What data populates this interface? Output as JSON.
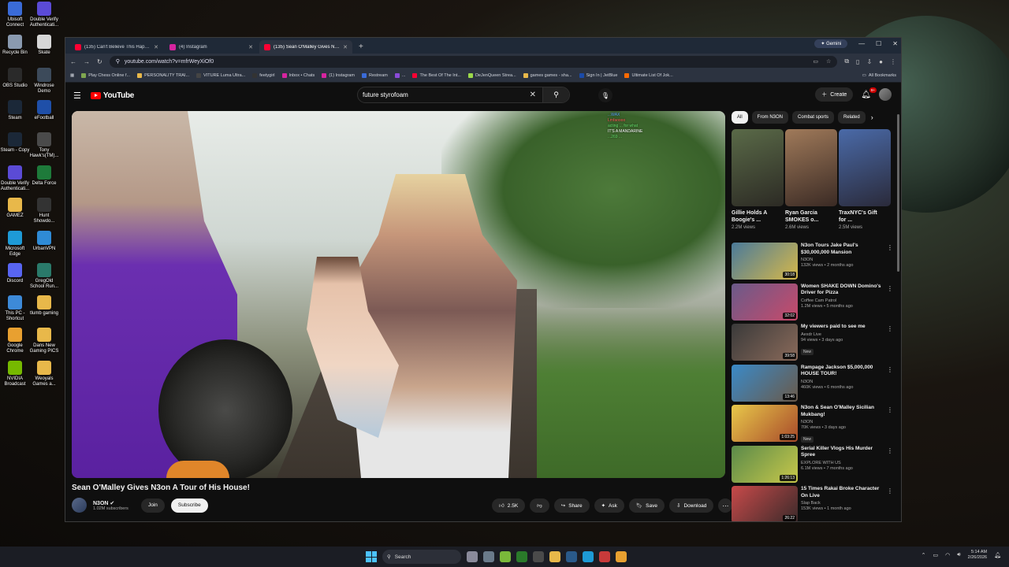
{
  "desktop": {
    "icons": [
      {
        "label": "Ubisoft Connect",
        "icon": "ubisoft-icon",
        "color": "#3a6bd8"
      },
      {
        "label": "Double Verify Authenticati...",
        "icon": "doubleverify-icon",
        "color": "#5b4bd6"
      },
      {
        "label": "Recycle Bin",
        "icon": "recycle-bin-icon",
        "color": "#8a9ab0"
      },
      {
        "label": "Skate",
        "icon": "skate-icon",
        "color": "#d6d6d6"
      },
      {
        "label": "OBS Studio",
        "icon": "obs-icon",
        "color": "#2a2a2a"
      },
      {
        "label": "Windrose Demo",
        "icon": "windrose-icon",
        "color": "#3c4a5a"
      },
      {
        "label": "Steam",
        "icon": "steam-icon",
        "color": "#1b2838"
      },
      {
        "label": "eFootball",
        "icon": "efootball-icon",
        "color": "#1f4fa8"
      },
      {
        "label": "Steam - Copy",
        "icon": "steam-icon",
        "color": "#1b2838"
      },
      {
        "label": "Tony Hawk's(TM)...",
        "icon": "tonyhawk-icon",
        "color": "#4a4a4a"
      },
      {
        "label": "Double Verify Authenticati...",
        "icon": "doubleverify-icon",
        "color": "#5b4bd6"
      },
      {
        "label": "Delta Force",
        "icon": "deltaforce-icon",
        "color": "#1e7a3a"
      },
      {
        "label": "GAMEZ",
        "icon": "folder-icon",
        "color": "#e8b84a"
      },
      {
        "label": "Hunt Showdo...",
        "icon": "hunt-icon",
        "color": "#333333"
      },
      {
        "label": "Microsoft Edge",
        "icon": "edge-icon",
        "color": "#1e9ad6"
      },
      {
        "label": "UrbanVPN",
        "icon": "urbanvpn-icon",
        "color": "#2f8bd6"
      },
      {
        "label": "Discord",
        "icon": "discord-icon",
        "color": "#5865f2"
      },
      {
        "label": "GregOld School Run...",
        "icon": "runescape-icon",
        "color": "#2a7a6a"
      },
      {
        "label": "This PC - Shortcut",
        "icon": "pc-icon",
        "color": "#3d8ad8"
      },
      {
        "label": "tlumb gaming",
        "icon": "folder-icon",
        "color": "#e8b84a"
      },
      {
        "label": "Google Chrome",
        "icon": "chrome-icon",
        "color": "#e8a030"
      },
      {
        "label": "Dans New Gaming PICS",
        "icon": "folder-icon",
        "color": "#e8b84a"
      },
      {
        "label": "NVIDIA Broadcast",
        "icon": "nvidia-icon",
        "color": "#76b900"
      },
      {
        "label": "Weoyals Games a...",
        "icon": "folder-icon",
        "color": "#e8b84a"
      }
    ]
  },
  "browser": {
    "tabs": [
      {
        "label": "(135) Can't Believe This Happe...",
        "icon": "youtube-icon",
        "color": "#ff0033",
        "active": false
      },
      {
        "label": "(4) Instagram",
        "icon": "instagram-icon",
        "color": "#d6249f",
        "active": false
      },
      {
        "label": "(135) Sean O'Malley Gives N3o...",
        "icon": "youtube-icon",
        "color": "#ff0033",
        "active": true
      }
    ],
    "new_tab": "+",
    "gemini_label": "Gemini",
    "window_controls": {
      "minimize": "—",
      "maximize": "☐",
      "close": "✕"
    },
    "nav": {
      "back": "←",
      "forward": "→",
      "reload": "↻"
    },
    "url": "youtube.com/watch?v=mfrWeyXiOf0",
    "bookmarks": [
      {
        "label": "Play Chess Online f...",
        "color": "#7fa650"
      },
      {
        "label": "PERSONALITY TRAI...",
        "color": "#e8b84a"
      },
      {
        "label": "VITURE Luma Ultra...",
        "color": "#444444"
      },
      {
        "label": "feetygirl",
        "color": "#333333"
      },
      {
        "label": "Inbox • Chats",
        "color": "#d6249f"
      },
      {
        "label": "(1) Instagram",
        "color": "#d6249f"
      },
      {
        "label": "Restream",
        "color": "#3a6bd8"
      },
      {
        "label": "...",
        "color": "#8a4ad8"
      },
      {
        "label": "The Best Of The Int...",
        "color": "#ff0033"
      },
      {
        "label": "DeJenQueen Strea...",
        "color": "#9bd84a"
      },
      {
        "label": "games games - sha...",
        "color": "#e8b84a"
      },
      {
        "label": "Sign In | JetBlue",
        "color": "#1a4aa8"
      },
      {
        "label": "Ultimate List Of Jok...",
        "color": "#ff6a00"
      }
    ],
    "all_bookmarks": "All Bookmarks"
  },
  "youtube": {
    "logo_text": "YouTube",
    "search_value": "future styrofoam",
    "search_placeholder": "Search",
    "create_label": "Create",
    "notif_count": "9+",
    "video": {
      "title": "Sean O'Malley Gives N3on A Tour of His House!",
      "chat": [
        {
          "user": "blue",
          "text": "...WAX"
        },
        {
          "user": "red",
          "text": "Lmfaoooo"
        },
        {
          "user": "green",
          "text": "acting ... for what"
        },
        {
          "user": "white",
          "text": "IT'S A MANDARINE"
        },
        {
          "user": "green",
          "text": "...269 ..."
        }
      ]
    },
    "channel": {
      "name": "N3ON",
      "subscribers": "1.02M subscribers",
      "join_label": "Join",
      "subscribe_label": "Subscribe"
    },
    "actions": {
      "likes": "2.5K",
      "share_label": "Share",
      "ask_label": "Ask",
      "save_label": "Save",
      "download_label": "Download"
    },
    "chips": [
      "All",
      "From N3ON",
      "Combat sports",
      "Related"
    ],
    "shorts": [
      {
        "title": "Gillie Holds A Boogie's ...",
        "views": "2.2M views",
        "c1": "#5a6a48",
        "c2": "#2c2a24"
      },
      {
        "title": "Ryan Garcia SMOKES o...",
        "views": "2.6M views",
        "c1": "#a07a5a",
        "c2": "#3a2a24"
      },
      {
        "title": "TraxNYC's Gift for ...",
        "views": "2.5M views",
        "c1": "#4a6aa8",
        "c2": "#2a2a3a"
      }
    ],
    "recommendations": [
      {
        "title": "N3on Tours Jake Paul's $30,000,000 Mansion",
        "channel": "N3ON",
        "meta": "132K views • 2 months ago",
        "duration": "30:18",
        "new": "",
        "c1": "#4a7a9a",
        "c2": "#d6b84a"
      },
      {
        "title": "Women SHAKE DOWN Domino's Driver for Pizza",
        "channel": "Coffee Cam Patrol",
        "meta": "1.2M views • 5 months ago",
        "duration": "32:02",
        "new": "",
        "c1": "#6a5a8a",
        "c2": "#c84a6a"
      },
      {
        "title": "My viewers paid to see me",
        "channel": "Aexdr Live",
        "meta": "94 views • 3 days ago",
        "duration": "39:58",
        "new": "New",
        "c1": "#3a3a3a",
        "c2": "#8a6a5a"
      },
      {
        "title": "Rampage Jackson $5,000,000 HOUSE TOUR!",
        "channel": "N3ON",
        "meta": "460K views • 6 months ago",
        "duration": "13:46",
        "new": "",
        "c1": "#3a8ac8",
        "c2": "#6a5a4a"
      },
      {
        "title": "N3on & Sean O'Malley Sicilian Mukbang!",
        "channel": "N3ON",
        "meta": "70K views • 3 days ago",
        "duration": "1:03:25",
        "new": "New",
        "c1": "#e8c84a",
        "c2": "#a84a2a"
      },
      {
        "title": "Serial Killer Vlogs His Murder Spree",
        "channel": "EXPLORE WITH US",
        "meta": "6.1M views • 7 months ago",
        "duration": "1:26:13",
        "new": "",
        "c1": "#5a8a4a",
        "c2": "#c8c84a"
      },
      {
        "title": "15 Times Rakai Broke Character On Live",
        "channel": "Slap Back",
        "meta": "153K views • 1 month ago",
        "duration": "26:22",
        "new": "",
        "c1": "#c84a4a",
        "c2": "#3a2a2a"
      }
    ]
  },
  "taskbar": {
    "search_label": "Search",
    "time": "5:14 AM",
    "date": "2/26/2026",
    "apps": [
      {
        "icon": "task-view-icon",
        "color": "#8a8a9a"
      },
      {
        "icon": "settings-icon",
        "color": "#6a7a8a"
      },
      {
        "icon": "media-player-icon",
        "color": "#7ab83a"
      },
      {
        "icon": "xbox-icon",
        "color": "#2a7a2a"
      },
      {
        "icon": "terminal-icon",
        "color": "#4a4a4a"
      },
      {
        "icon": "file-explorer-icon",
        "color": "#e8b84a"
      },
      {
        "icon": "steam-icon",
        "color": "#2a5a8a"
      },
      {
        "icon": "edge-icon",
        "color": "#1e9ad6"
      },
      {
        "icon": "photos-icon",
        "color": "#c83a3a"
      },
      {
        "icon": "chrome-icon",
        "color": "#e8a030"
      }
    ]
  }
}
